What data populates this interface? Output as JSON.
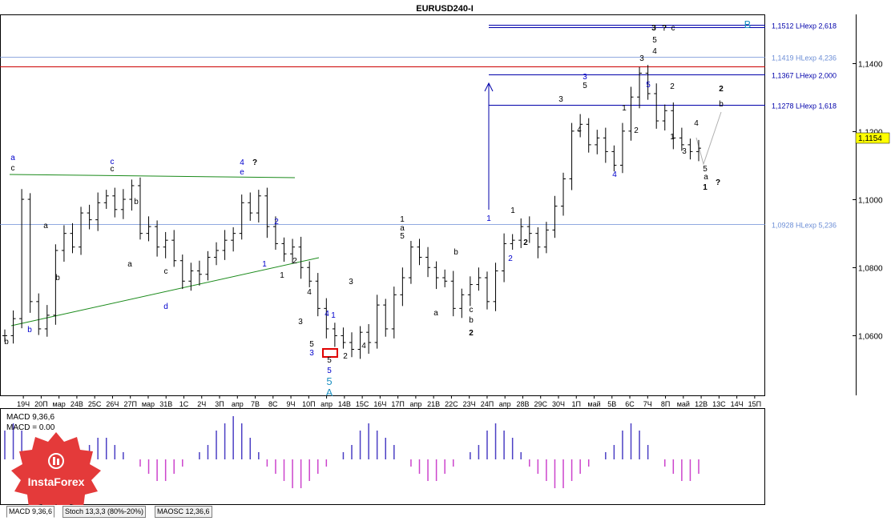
{
  "window": {
    "title": "EURUSD240-I"
  },
  "chart_data": {
    "type": "candlestick",
    "symbol": "EURUSD240-I",
    "ylim": [
      1.0425,
      1.154
    ],
    "y_ticks": [
      "1,1400",
      "1,1200",
      "1,1000",
      "1,0800",
      "1,0600"
    ],
    "y_tick_values": [
      1.14,
      1.12,
      1.1,
      1.08,
      1.06
    ],
    "current_price": {
      "label": "1,1154",
      "value": 1.1154
    },
    "x_ticks": [
      "19Ч",
      "20П",
      "мар",
      "24В",
      "25С",
      "26Ч",
      "27П",
      "мар",
      "31В",
      "1С",
      "2Ч",
      "3П",
      "апр",
      "7В",
      "8С",
      "9Ч",
      "10П",
      "апр",
      "14В",
      "15С",
      "16Ч",
      "17П",
      "апр",
      "21В",
      "22С",
      "23Ч",
      "24П",
      "апр",
      "28В",
      "29С",
      "30Ч",
      "1П",
      "май",
      "5В",
      "6С",
      "7Ч",
      "8П",
      "май",
      "12В",
      "13С",
      "14Ч",
      "15П"
    ],
    "levels": [
      {
        "label": "1,1512 LHexp 2,618",
        "value": 1.1512,
        "style": "double-blue"
      },
      {
        "label": "1,1419 HLexp 4,236",
        "value": 1.1419,
        "style": "light-blue"
      },
      {
        "label": "",
        "value": 1.139,
        "style": "red"
      },
      {
        "label": "1,1367 LHexp 2,000",
        "value": 1.1367,
        "style": "blue"
      },
      {
        "label": "1,1278 LHexp 1,618",
        "value": 1.1278,
        "style": "blue"
      },
      {
        "label": "1,0928 HLexp 5,236",
        "value": 1.0928,
        "style": "light-blue"
      }
    ],
    "closes": [
      1.06,
      1.065,
      1.1,
      1.07,
      1.062,
      1.066,
      1.085,
      1.09,
      1.086,
      1.096,
      1.094,
      1.099,
      1.101,
      1.097,
      1.1,
      1.104,
      1.09,
      1.092,
      1.086,
      1.088,
      1.082,
      1.076,
      1.079,
      1.078,
      1.083,
      1.085,
      1.088,
      1.09,
      1.099,
      1.096,
      1.101,
      1.092,
      1.087,
      1.084,
      1.086,
      1.08,
      1.076,
      1.068,
      1.062,
      1.06,
      1.058,
      1.056,
      1.061,
      1.058,
      1.069,
      1.062,
      1.072,
      1.077,
      1.086,
      1.083,
      1.08,
      1.077,
      1.076,
      1.068,
      1.072,
      1.075,
      1.077,
      1.07,
      1.079,
      1.087,
      1.088,
      1.092,
      1.09,
      1.086,
      1.091,
      1.098,
      1.106,
      1.12,
      1.122,
      1.116,
      1.118,
      1.114,
      1.11,
      1.12,
      1.13,
      1.137,
      1.131,
      1.123,
      1.126,
      1.118,
      1.116,
      1.114,
      1.115
    ],
    "macd": {
      "label": "MACD 9,36,6",
      "value_label": "MACD = 0.00"
    },
    "macd_values": [
      4,
      5,
      4,
      0,
      -2,
      -3,
      -4,
      -3,
      -1,
      1,
      2,
      3,
      3,
      2,
      1,
      0,
      -1,
      -2,
      -3,
      -3,
      -2,
      -1,
      0,
      1,
      2,
      4,
      5,
      6,
      5,
      3,
      1,
      -1,
      -2,
      -3,
      -4,
      -4,
      -3,
      -2,
      -1,
      0,
      1,
      2,
      4,
      5,
      4,
      3,
      2,
      0,
      -1,
      -2,
      -3,
      -3,
      -2,
      -1,
      0,
      1,
      2,
      4,
      5,
      4,
      3,
      1,
      -1,
      -2,
      -3,
      -4,
      -4,
      -3,
      -2,
      -1,
      0,
      1,
      2,
      4,
      5,
      4,
      2,
      0,
      -1,
      -2,
      -3,
      -3,
      -2
    ],
    "wave_labels": [
      {
        "text": "a",
        "color": "#0000cc"
      },
      {
        "text": "c",
        "color": "#000000"
      },
      {
        "text": "b",
        "color": "#000000"
      },
      {
        "text": "b",
        "color": "#0000cc"
      },
      {
        "text": "a",
        "color": "#000000"
      },
      {
        "text": "b",
        "color": "#000000"
      },
      {
        "text": "c",
        "color": "#0000cc"
      },
      {
        "text": "c",
        "color": "#000000"
      },
      {
        "text": "b",
        "color": "#000000"
      },
      {
        "text": "a",
        "color": "#000000"
      },
      {
        "text": "c",
        "color": "#000000"
      },
      {
        "text": "d",
        "color": "#0000cc"
      },
      {
        "text": "4",
        "color": "#0000cc"
      },
      {
        "text": "e",
        "color": "#0000cc"
      },
      {
        "text": "?",
        "color": "#000000"
      },
      {
        "text": "2",
        "color": "#0000cc"
      },
      {
        "text": "1",
        "color": "#0000cc"
      },
      {
        "text": "2",
        "color": "#000000"
      },
      {
        "text": "1",
        "color": "#000000"
      },
      {
        "text": "4",
        "color": "#000000"
      },
      {
        "text": "3",
        "color": "#000000"
      },
      {
        "text": "5",
        "color": "#000000"
      },
      {
        "text": "3",
        "color": "#0000cc"
      },
      {
        "text": "4",
        "color": "#0000cc"
      },
      {
        "text": "1",
        "color": "#0000cc"
      },
      {
        "text": "5",
        "color": "#000000"
      },
      {
        "text": "5",
        "color": "#0000cc"
      },
      {
        "text": "2",
        "color": "#000000"
      },
      {
        "text": "5",
        "color": "#1e90c0"
      },
      {
        "text": "A",
        "color": "#1e90c0"
      },
      {
        "text": "3",
        "color": "#000000"
      },
      {
        "text": "4",
        "color": "#000000"
      },
      {
        "text": "1",
        "color": "#000000"
      },
      {
        "text": "a",
        "color": "#000000"
      },
      {
        "text": "5",
        "color": "#000000"
      },
      {
        "text": "a",
        "color": "#000000"
      },
      {
        "text": "b",
        "color": "#000000"
      },
      {
        "text": "c",
        "color": "#000000"
      },
      {
        "text": "b",
        "color": "#000000"
      },
      {
        "text": "2",
        "color": "#000000"
      },
      {
        "text": "1",
        "color": "#0000cc"
      },
      {
        "text": "1",
        "color": "#000000"
      },
      {
        "text": "2",
        "color": "#0000cc"
      },
      {
        "text": "2",
        "color": "#000000"
      },
      {
        "text": "3",
        "color": "#000000"
      },
      {
        "text": "3",
        "color": "#0000cc"
      },
      {
        "text": "5",
        "color": "#000000"
      },
      {
        "text": "4",
        "color": "#000000"
      },
      {
        "text": "4",
        "color": "#0000cc"
      },
      {
        "text": "1",
        "color": "#000000"
      },
      {
        "text": "2",
        "color": "#000000"
      },
      {
        "text": "3",
        "color": "#000000"
      },
      {
        "text": "4",
        "color": "#000000"
      },
      {
        "text": "5",
        "color": "#000000"
      },
      {
        "text": "5",
        "color": "#0000cc"
      },
      {
        "text": "3",
        "color": "#000000"
      },
      {
        "text": "?",
        "color": "#000000"
      },
      {
        "text": "c",
        "color": "#000000"
      },
      {
        "text": "2",
        "color": "#000000"
      },
      {
        "text": "1",
        "color": "#000000"
      },
      {
        "text": "4",
        "color": "#000000"
      },
      {
        "text": "3",
        "color": "#000000"
      },
      {
        "text": "5",
        "color": "#000000"
      },
      {
        "text": "a",
        "color": "#000000"
      },
      {
        "text": "1",
        "color": "#000000"
      },
      {
        "text": "?",
        "color": "#000000"
      },
      {
        "text": "2",
        "color": "#000000"
      },
      {
        "text": "b",
        "color": "#000000"
      },
      {
        "text": "B",
        "color": "#1e90c0"
      }
    ]
  },
  "indicator_tabs": [
    "MACD 9,36,6",
    "Stoch 13,3,3 (80%-20%)",
    "MAOSC 12,36,6"
  ],
  "logo": {
    "text": "InstaForex",
    "icon": "instaforex-logo-icon"
  },
  "colors": {
    "candle": "#000000",
    "macd_pos": "#4b3fc4",
    "macd_neg": "#cc44cc",
    "level_blue": "#0000aa",
    "level_light": "#6c8ed6",
    "level_red": "#cc0000",
    "trend_green": "#1a8a1a",
    "price_tag": "#ffff00"
  }
}
